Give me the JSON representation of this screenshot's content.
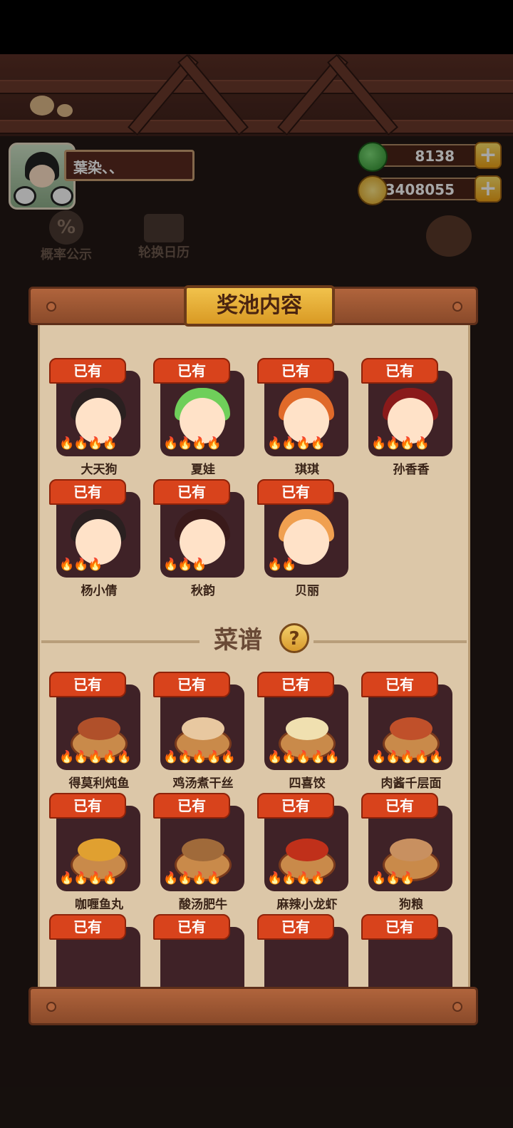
{
  "user": {
    "name": "葉染、、"
  },
  "resources": {
    "jade": "8138",
    "coins": "3408055",
    "plus": "+"
  },
  "background": {
    "prob_icon": "%",
    "prob_label": "概率公示",
    "calendar_label": "轮换日历"
  },
  "modal": {
    "title": "奖池内容",
    "owned_badge": "已有",
    "characters": [
      {
        "name": "大天狗",
        "flames": 4
      },
      {
        "name": "夏娃",
        "flames": 4
      },
      {
        "name": "琪琪",
        "flames": 4
      },
      {
        "name": "孙香香",
        "flames": 4
      },
      {
        "name": "杨小倩",
        "flames": 3
      },
      {
        "name": "秋韵",
        "flames": 3
      },
      {
        "name": "贝丽",
        "flames": 2
      }
    ],
    "recipes_title": "菜谱",
    "help_icon": "?",
    "recipes": [
      {
        "name": "得莫利炖鱼",
        "flames": 5
      },
      {
        "name": "鸡汤煮干丝",
        "flames": 5
      },
      {
        "name": "四喜饺",
        "flames": 5
      },
      {
        "name": "肉酱千层面",
        "flames": 5
      },
      {
        "name": "咖喱鱼丸",
        "flames": 4
      },
      {
        "name": "酸汤肥牛",
        "flames": 4
      },
      {
        "name": "麻辣小龙虾",
        "flames": 4
      },
      {
        "name": "狗粮",
        "flames": 3
      },
      {
        "name": "",
        "flames": 0
      },
      {
        "name": "",
        "flames": 0
      },
      {
        "name": "",
        "flames": 0
      },
      {
        "name": "",
        "flames": 0
      }
    ]
  }
}
